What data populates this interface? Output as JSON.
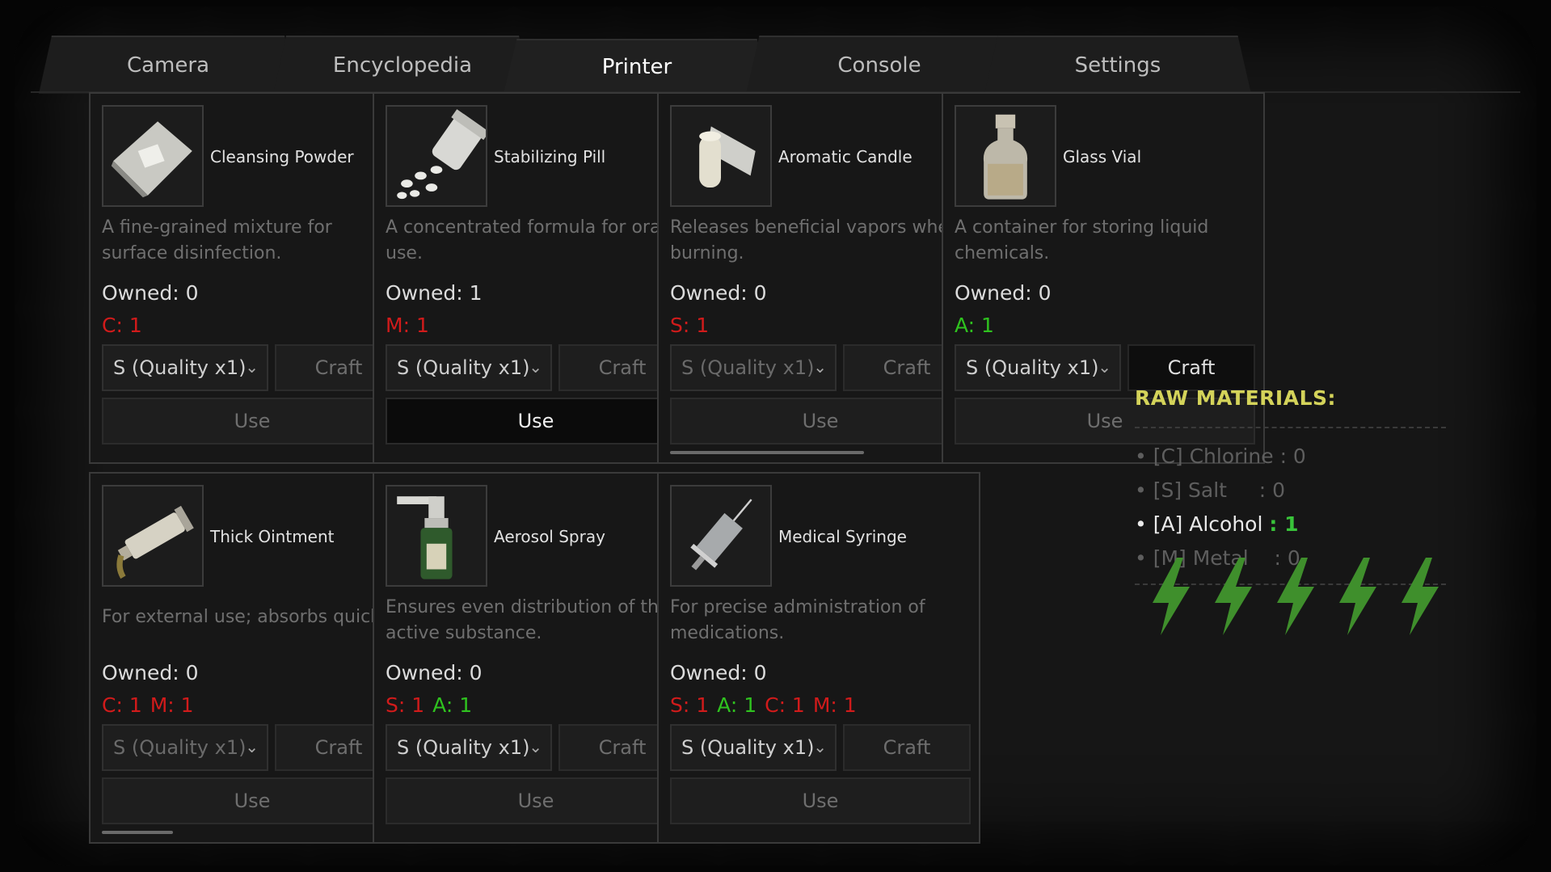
{
  "tabs": [
    {
      "label": "Camera",
      "active": false
    },
    {
      "label": "Encyclopedia",
      "active": false
    },
    {
      "label": "Printer",
      "active": true
    },
    {
      "label": "Console",
      "active": false
    },
    {
      "label": "Settings",
      "active": false
    }
  ],
  "cards": [
    {
      "name": "Cleansing Powder",
      "icon": "powder-icon",
      "description": "A fine-grained mixture for surface disinfection.",
      "owned": "Owned: 0",
      "requirements": [
        {
          "text": "C: 1",
          "met": false
        }
      ],
      "quality": "S (Quality x1)",
      "craft_label": "Craft",
      "craft_enabled": false,
      "use_label": "Use",
      "use_enabled": false
    },
    {
      "name": "Stabilizing Pill",
      "icon": "pill-bottle-icon",
      "description": "A concentrated formula for oral use.",
      "owned": "Owned: 1",
      "requirements": [
        {
          "text": "M: 1",
          "met": false
        }
      ],
      "quality": "S (Quality x1)",
      "craft_label": "Craft",
      "craft_enabled": false,
      "use_label": "Use",
      "use_enabled": true
    },
    {
      "name": "Aromatic Candle",
      "icon": "candle-icon",
      "description": "Releases beneficial vapors when burning.",
      "owned": "Owned: 0",
      "requirements": [
        {
          "text": "S: 1",
          "met": false
        }
      ],
      "quality": "S (Quality x1)",
      "craft_label": "Craft",
      "craft_enabled": false,
      "use_label": "Use",
      "use_enabled": false
    },
    {
      "name": "Glass Vial",
      "icon": "vial-icon",
      "description": "A container for storing liquid chemicals.",
      "owned": "Owned: 0",
      "requirements": [
        {
          "text": "A: 1",
          "met": true
        }
      ],
      "quality": "S (Quality x1)",
      "craft_label": "Craft",
      "craft_enabled": true,
      "use_label": "Use",
      "use_enabled": false
    },
    {
      "name": "Thick Ointment",
      "icon": "ointment-tube-icon",
      "description": "For external use; absorbs quickly.",
      "owned": "Owned: 0",
      "requirements": [
        {
          "text": "C: 1",
          "met": false
        },
        {
          "text": "M: 1",
          "met": false
        }
      ],
      "quality": "S (Quality x1)",
      "craft_label": "Craft",
      "craft_enabled": false,
      "use_label": "Use",
      "use_enabled": false
    },
    {
      "name": "Aerosol Spray",
      "icon": "spray-bottle-icon",
      "description": "Ensures even distribution of the active substance.",
      "owned": "Owned: 0",
      "requirements": [
        {
          "text": "S: 1",
          "met": false
        },
        {
          "text": "A: 1",
          "met": true
        }
      ],
      "quality": "S (Quality x1)",
      "craft_label": "Craft",
      "craft_enabled": false,
      "use_label": "Use",
      "use_enabled": false
    },
    {
      "name": "Medical Syringe",
      "icon": "syringe-icon",
      "description": "For precise administration of medications.",
      "owned": "Owned: 0",
      "requirements": [
        {
          "text": "S: 1",
          "met": false
        },
        {
          "text": "A: 1",
          "met": true
        },
        {
          "text": "C: 1",
          "met": false
        },
        {
          "text": "M: 1",
          "met": false
        }
      ],
      "quality": "S (Quality x1)",
      "craft_label": "Craft",
      "craft_enabled": false,
      "use_label": "Use",
      "use_enabled": false
    }
  ],
  "raw_materials": {
    "title": "RAW MATERIALS:",
    "items": [
      {
        "label": "• [C] Chlorine",
        "count": ": 0",
        "active": false
      },
      {
        "label": "• [S] Salt    ",
        "count": ": 0",
        "active": false
      },
      {
        "label": "• [A] Alcohol",
        "count": ": 1",
        "active": true
      },
      {
        "label": "• [M] Metal   ",
        "count": ": 0",
        "active": false
      }
    ]
  },
  "energy": {
    "icon": "lightning-bolt-icon",
    "count": 5,
    "color": "#3f8f2c"
  },
  "colors": {
    "requirement_missing": "#d11b1b",
    "requirement_met": "#2fc21f",
    "raw_title": "#d4d35a"
  }
}
